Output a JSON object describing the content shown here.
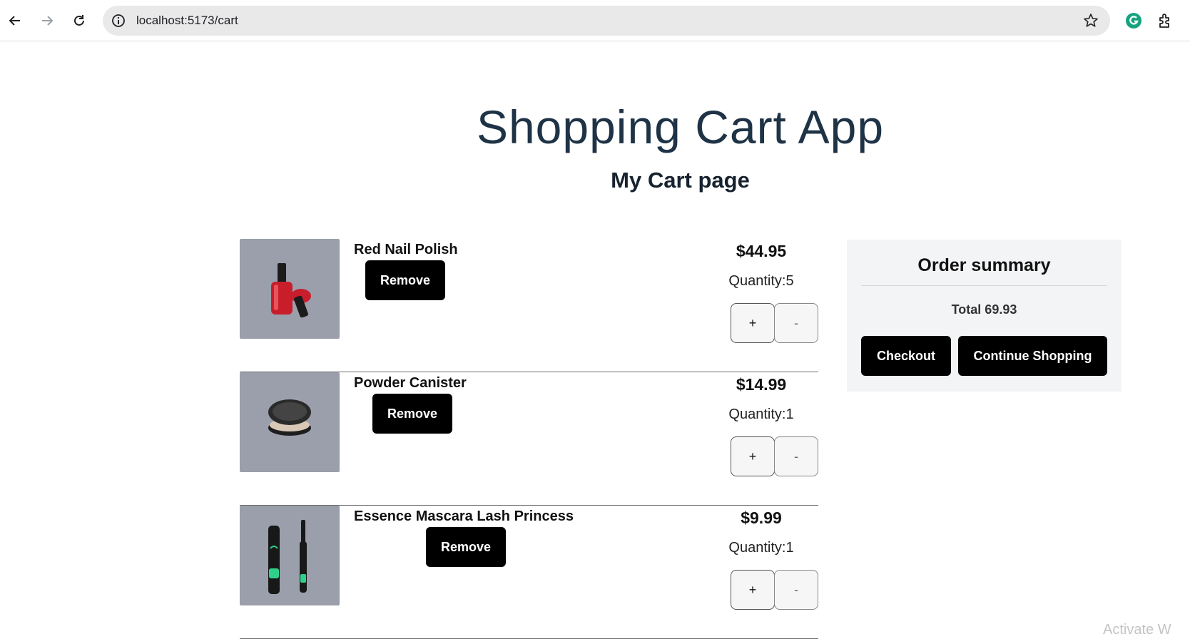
{
  "browser": {
    "url": "localhost:5173/cart"
  },
  "app": {
    "title": "Shopping Cart App",
    "page_title": "My Cart page"
  },
  "cart": {
    "remove_label": "Remove",
    "plus_label": "+",
    "minus_label": "-",
    "items": [
      {
        "name": "Red Nail Polish",
        "price": "$44.95",
        "quantity": "Quantity:5",
        "icon": "nail-polish"
      },
      {
        "name": "Powder Canister",
        "price": "$14.99",
        "quantity": "Quantity:1",
        "icon": "powder-compact"
      },
      {
        "name": "Essence Mascara Lash Princess",
        "price": "$9.99",
        "quantity": "Quantity:1",
        "icon": "mascara"
      }
    ]
  },
  "summary": {
    "title": "Order summary",
    "total": "Total 69.93",
    "checkout_label": "Checkout",
    "continue_label": "Continue Shopping"
  },
  "watermark": "Activate W",
  "colors": {
    "title": "#1f3346",
    "button_bg": "#000000",
    "thumb_bg": "#9a9fab",
    "summary_bg": "#f3f4f5"
  }
}
